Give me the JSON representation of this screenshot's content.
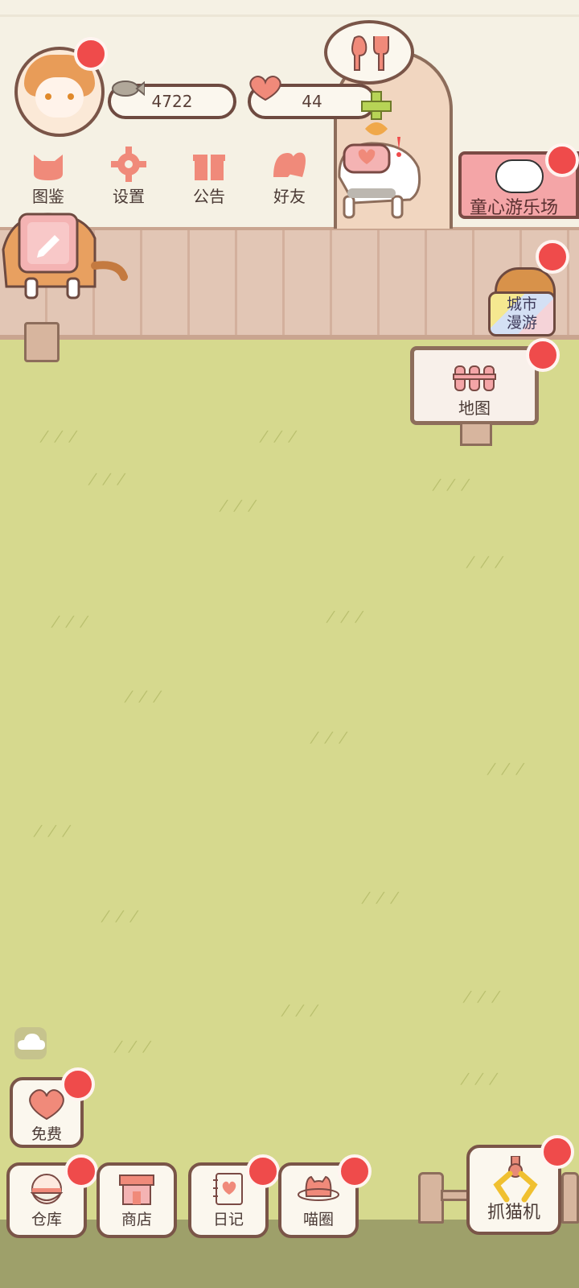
{
  "resources": {
    "fish": "4722",
    "hearts": "44"
  },
  "menu": [
    {
      "label": "图鉴",
      "icon": "cat-face-icon"
    },
    {
      "label": "设置",
      "icon": "gear-icon"
    },
    {
      "label": "公告",
      "icon": "gift-icon"
    },
    {
      "label": "好友",
      "icon": "friends-icon"
    }
  ],
  "events": {
    "paradise_label": "童心游乐场",
    "city_label": [
      "城市",
      "漫游"
    ],
    "map_label": "地图"
  },
  "bottom": {
    "free_label": "免费",
    "warehouse_label": "仓库",
    "shop_label": "商店",
    "diary_label": "日记",
    "circle_label": "喵圈",
    "claw_label": "抓猫机"
  },
  "colors": {
    "accent": "#f08a7a",
    "notification": "#ef4b4b",
    "grass": "#d6d98e",
    "outline": "#7a5548"
  }
}
